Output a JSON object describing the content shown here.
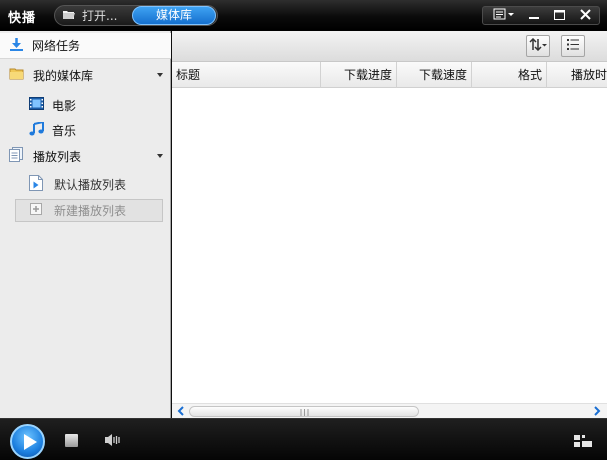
{
  "titlebar": {
    "app_title": "快播",
    "tabs": {
      "open": "打开...",
      "library": "媒体库"
    }
  },
  "sidebar": {
    "network_tasks": "网络任务",
    "media_library": "我的媒体库",
    "movies": "电影",
    "music": "音乐",
    "playlists": "播放列表",
    "default_playlist": "默认播放列表",
    "new_playlist": "新建播放列表"
  },
  "table": {
    "columns": [
      "标题",
      "下载进度",
      "下载速度",
      "格式",
      "播放时"
    ]
  },
  "colors": {
    "accent": "#1e7fe0",
    "titlebar": "#0b0b0b",
    "sidebar": "#ececec"
  },
  "icons": {
    "menu": "menu-icon",
    "minimize": "minimize-icon",
    "maximize": "maximize-icon",
    "close": "close-icon",
    "sort": "sort-icon",
    "view": "list-view-icon",
    "download": "download-icon",
    "folder": "folder-icon",
    "film": "film-icon",
    "music": "music-note-icon",
    "playlist": "playlist-icon",
    "play": "play-icon",
    "stop": "stop-icon",
    "volume": "volume-icon",
    "grid": "grid-icon"
  }
}
